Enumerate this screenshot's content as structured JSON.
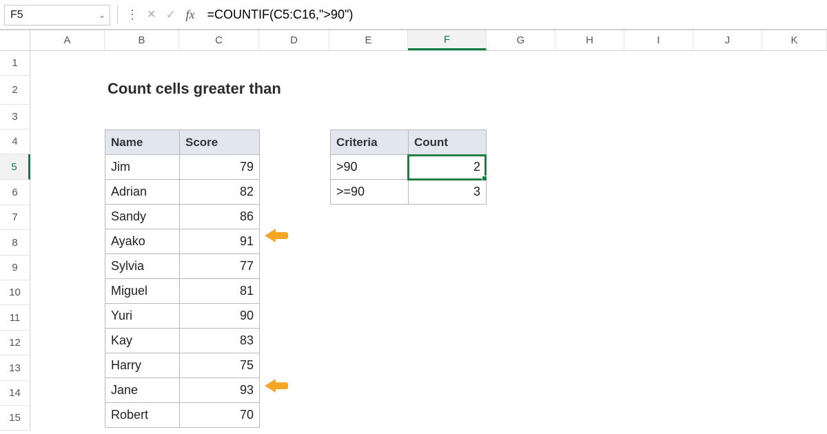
{
  "formula_bar": {
    "active_cell": "F5",
    "formula": "=COUNTIF(C5:C16,\">90\")"
  },
  "columns": [
    "A",
    "B",
    "C",
    "D",
    "E",
    "F",
    "G",
    "H",
    "I",
    "J",
    "K"
  ],
  "active_col": "F",
  "rows": [
    "1",
    "2",
    "3",
    "4",
    "5",
    "6",
    "7",
    "8",
    "9",
    "10",
    "11",
    "12",
    "13",
    "14",
    "15"
  ],
  "active_row": "5",
  "title": "Count cells greater than",
  "main_table": {
    "headers": {
      "name": "Name",
      "score": "Score"
    },
    "rows": [
      {
        "name": "Jim",
        "score": 79
      },
      {
        "name": "Adrian",
        "score": 82
      },
      {
        "name": "Sandy",
        "score": 86
      },
      {
        "name": "Ayako",
        "score": 91
      },
      {
        "name": "Sylvia",
        "score": 77
      },
      {
        "name": "Miguel",
        "score": 81
      },
      {
        "name": "Yuri",
        "score": 90
      },
      {
        "name": "Kay",
        "score": 83
      },
      {
        "name": "Harry",
        "score": 75
      },
      {
        "name": "Jane",
        "score": 93
      },
      {
        "name": "Robert",
        "score": 70
      }
    ]
  },
  "result_table": {
    "headers": {
      "criteria": "Criteria",
      "count": "Count"
    },
    "rows": [
      {
        "criteria": ">90",
        "count": 2
      },
      {
        "criteria": ">=90",
        "count": 3
      }
    ]
  },
  "icons": {
    "chevron_down": "⌄",
    "vertical_dots": "⋮",
    "cancel": "✕",
    "enter": "✓",
    "fx": "fx"
  }
}
